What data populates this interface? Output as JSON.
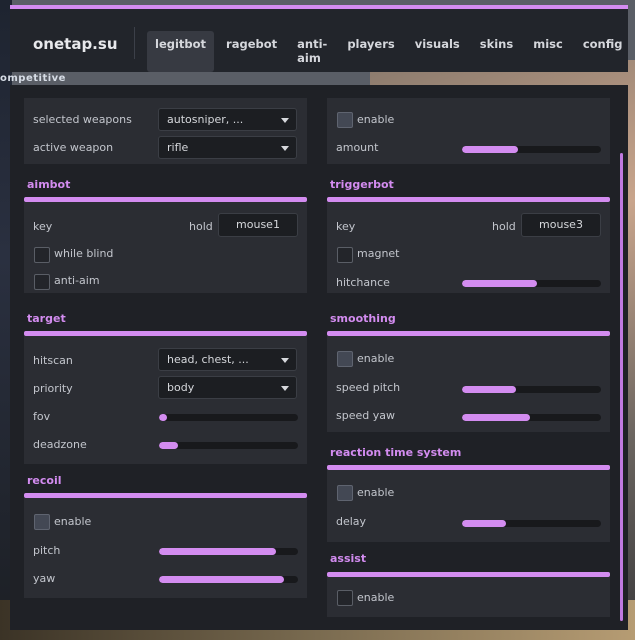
{
  "background": {
    "text": "ompetitive"
  },
  "header": {
    "logo": "onetap.su",
    "tabs": [
      "legitbot",
      "ragebot",
      "anti-aim",
      "players",
      "visuals",
      "skins",
      "misc",
      "config"
    ],
    "active_tab": "legitbot"
  },
  "colors": {
    "accent": "#d38cf0",
    "panel": "#2b2d33",
    "window": "#1f2126"
  },
  "weapons": {
    "selected_label": "selected weapons",
    "selected_value": "autosniper, ...",
    "active_label": "active weapon",
    "active_value": "rifle"
  },
  "top_right": {
    "enable_label": "enable",
    "amount_label": "amount",
    "amount_value": 0.4
  },
  "aimbot": {
    "title": "aimbot",
    "key_label": "key",
    "key_mode": "hold",
    "key_value": "mouse1",
    "while_blind_label": "while blind",
    "anti_aim_label": "anti-aim"
  },
  "triggerbot": {
    "title": "triggerbot",
    "key_label": "key",
    "key_mode": "hold",
    "key_value": "mouse3",
    "magnet_label": "magnet",
    "hitchance_label": "hitchance",
    "hitchance_value": 0.54
  },
  "target": {
    "title": "target",
    "hitscan_label": "hitscan",
    "hitscan_value": "head, chest, ...",
    "priority_label": "priority",
    "priority_value": "body",
    "fov_label": "fov",
    "fov_value": 0.06,
    "deadzone_label": "deadzone",
    "deadzone_value": 0.14
  },
  "smoothing": {
    "title": "smoothing",
    "enable_label": "enable",
    "speed_pitch_label": "speed pitch",
    "speed_pitch_value": 0.39,
    "speed_yaw_label": "speed yaw",
    "speed_yaw_value": 0.49
  },
  "recoil": {
    "title": "recoil",
    "enable_label": "enable",
    "pitch_label": "pitch",
    "pitch_value": 0.84,
    "yaw_label": "yaw",
    "yaw_value": 0.9
  },
  "reaction": {
    "title": "reaction time system",
    "enable_label": "enable",
    "delay_label": "delay",
    "delay_value": 0.32
  },
  "assist": {
    "title": "assist",
    "enable_label": "enable"
  }
}
